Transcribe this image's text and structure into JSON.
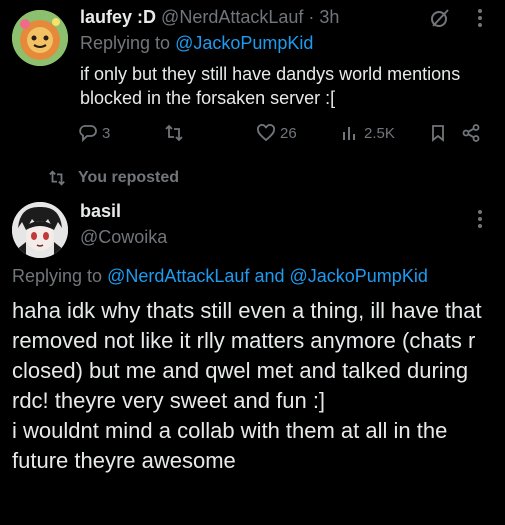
{
  "tweet1": {
    "display_name": "laufey :D",
    "handle": "@NerdAttackLauf",
    "separator": "·",
    "time": "3h",
    "replying_prefix": "Replying to",
    "replying_to": "@JackoPumpKid",
    "text": "if only but they still have dandys world mentions blocked in the forsaken server :[",
    "stats": {
      "replies": "3",
      "likes": "26",
      "views": "2.5K"
    },
    "icons": [
      "grok-icon",
      "more-icon",
      "reply-icon",
      "repost-icon",
      "like-icon",
      "views-icon",
      "bookmark-icon",
      "share-icon"
    ]
  },
  "repost_label": "You reposted",
  "tweet2": {
    "display_name": "basil",
    "handle": "@Cowoika",
    "replying_prefix": "Replying to",
    "replying_to_1": "@NerdAttackLauf",
    "replying_and": "and",
    "replying_to_2": "@JackoPumpKid",
    "text_p1": "haha idk why thats still even a thing, ill have that removed not like it rlly matters anymore (chats r closed) but me and qwel met and talked during rdc! theyre very sweet and fun :]",
    "text_p2": "i wouldnt mind a collab with them at all in the future theyre awesome"
  },
  "colors": {
    "background": "#000000",
    "text": "#e7e9ea",
    "muted": "#71767b",
    "link": "#1d9bf0"
  }
}
